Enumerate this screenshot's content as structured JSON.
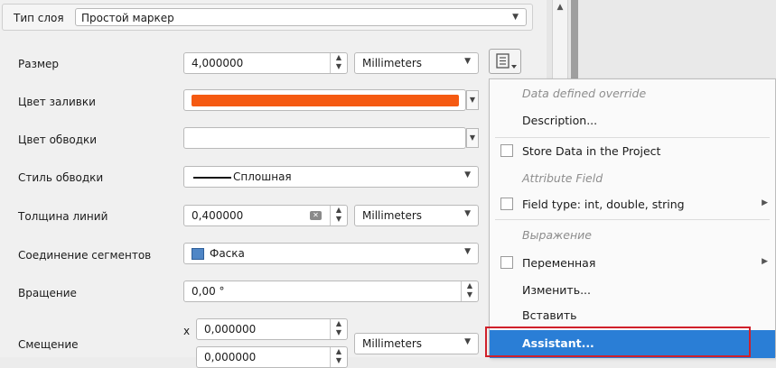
{
  "layer_type": {
    "label": "Тип слоя",
    "value": "Простой маркер"
  },
  "rows": {
    "size": {
      "label": "Размер",
      "value": "4,000000",
      "unit": "Millimeters"
    },
    "fill_color": {
      "label": "Цвет заливки",
      "color": "#f55a12"
    },
    "stroke_color": {
      "label": "Цвет обводки"
    },
    "stroke_style": {
      "label": "Стиль обводки",
      "value": "Сплошная"
    },
    "line_width": {
      "label": "Толщина линий",
      "value": "0,400000",
      "unit": "Millimeters"
    },
    "join_style": {
      "label": "Соединение сегментов",
      "value": "Фаска"
    },
    "rotation": {
      "label": "Вращение",
      "value": "0,00 °"
    },
    "offset": {
      "label": "Смещение",
      "x_label": "x",
      "x_value": "0,000000",
      "y_value": "0,000000",
      "unit": "Millimeters"
    }
  },
  "menu": {
    "header": "Data defined override",
    "description": "Description...",
    "store_data": "Store Data in the Project",
    "attribute_field_header": "Attribute Field",
    "field_type": "Field type: int, double, string",
    "expression_header": "Выражение",
    "variable": "Переменная",
    "edit": "Изменить...",
    "paste": "Вставить",
    "assistant": "Assistant..."
  },
  "colors": {
    "accent": "#2a7ed6",
    "highlight": "#d0202a",
    "fill": "#f55a12"
  }
}
